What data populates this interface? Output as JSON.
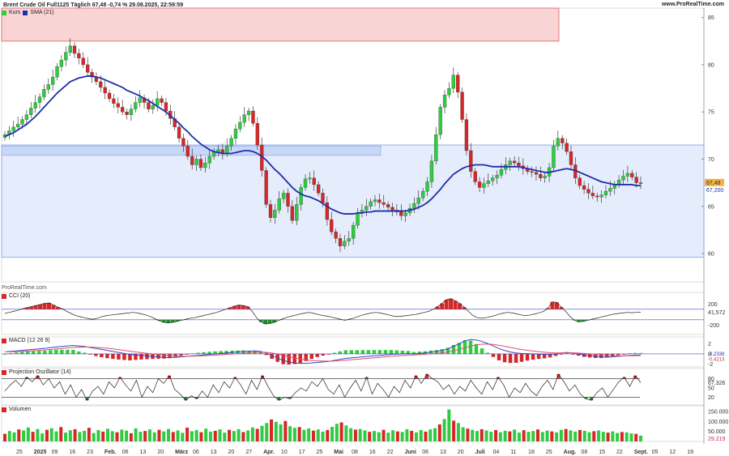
{
  "header": {
    "title": "Brent Crude Oil Full1125 Täglich 67,48 -0,74 % 29.08.2025, 22:59:59",
    "brand": "www.ProRealTime.com",
    "watermark": "ProRealTime.com"
  },
  "colors": {
    "up": "#2ecc40",
    "down": "#d62728",
    "sma": "#1f2fa8",
    "zone_blue": "#dfe7fb",
    "zone_red": "#f8c9c9",
    "macd_line": "#3446c8",
    "signal_line": "#e0506a"
  },
  "chart_data": [
    {
      "type": "candlestick",
      "legend": [
        "Kurs",
        "SMA (21)"
      ],
      "y_ticks": [
        "85",
        "80",
        "75",
        "70",
        "65",
        "60"
      ],
      "ylim": [
        57,
        86
      ],
      "last_price": "67,48",
      "sma_last": "67,200",
      "zones": [
        {
          "kind": "resistance",
          "from": 82.5,
          "to": 86
        },
        {
          "kind": "support",
          "from": 59.6,
          "to": 71.5
        }
      ],
      "x_ticks": [
        "25",
        "2025",
        "09",
        "16",
        "23",
        "Feb.",
        "06",
        "13",
        "20",
        "März",
        "06",
        "13",
        "20",
        "27",
        "Apr.",
        "10",
        "17",
        "25",
        "Mai",
        "08",
        "16",
        "22",
        "Juni",
        "06",
        "13",
        "20",
        "Juli",
        "04",
        "11",
        "18",
        "25",
        "Aug.",
        "08",
        "15",
        "22",
        "Sept.",
        "05",
        "12",
        "19"
      ],
      "closes": [
        72.6,
        73.0,
        73.4,
        73.7,
        74.2,
        74.7,
        75.4,
        76.0,
        76.6,
        77.4,
        77.9,
        78.7,
        79.8,
        80.5,
        81.3,
        82.0,
        81.2,
        80.7,
        80.0,
        79.2,
        78.7,
        78.2,
        77.6,
        77.0,
        76.4,
        75.9,
        75.5,
        75.0,
        74.7,
        75.3,
        76.0,
        76.5,
        76.0,
        75.3,
        75.7,
        76.4,
        76.0,
        75.1,
        74.3,
        73.4,
        72.2,
        71.4,
        70.3,
        69.4,
        70.0,
        69.1,
        69.6,
        70.3,
        70.8,
        71.0,
        70.6,
        71.4,
        72.2,
        73.2,
        73.9,
        74.7,
        75.1,
        73.8,
        71.5,
        68.8,
        65.2,
        63.8,
        64.6,
        65.8,
        66.4,
        65.0,
        63.5,
        65.2,
        67.0,
        67.9,
        68.0,
        67.3,
        66.4,
        65.4,
        63.6,
        62.3,
        61.6,
        60.8,
        61.3,
        61.6,
        63.0,
        64.3,
        64.6,
        65.0,
        65.5,
        65.7,
        65.4,
        65.2,
        64.9,
        64.6,
        64.4,
        64.0,
        64.3,
        64.8,
        65.3,
        65.9,
        66.6,
        67.6,
        69.8,
        72.6,
        75.5,
        76.8,
        77.5,
        78.9,
        77.1,
        74.2,
        70.9,
        68.7,
        67.6,
        67.0,
        67.4,
        67.7,
        68.0,
        68.3,
        68.9,
        69.4,
        69.8,
        69.6,
        69.3,
        69.0,
        68.7,
        68.6,
        68.4,
        68.0,
        68.2,
        69.1,
        71.4,
        72.2,
        71.7,
        70.8,
        69.4,
        68.0,
        67.2,
        66.8,
        66.4,
        66.1,
        66.0,
        66.2,
        66.6,
        66.9,
        67.3,
        67.8,
        68.2,
        68.5,
        68.1,
        67.5,
        67.48
      ],
      "sma": [
        72.4,
        72.6,
        72.8,
        73.1,
        73.4,
        73.7,
        74.1,
        74.5,
        75.0,
        75.5,
        76.0,
        76.5,
        77.0,
        77.4,
        77.8,
        78.2,
        78.4,
        78.6,
        78.7,
        78.8,
        78.8,
        78.7,
        78.6,
        78.4,
        78.2,
        78.0,
        77.8,
        77.6,
        77.3,
        77.1,
        76.9,
        76.7,
        76.4,
        76.2,
        75.9,
        75.6,
        75.3,
        75.0,
        74.6,
        74.2,
        73.8,
        73.3,
        72.9,
        72.4,
        72.0,
        71.6,
        71.3,
        71.0,
        70.8,
        70.7,
        70.6,
        70.6,
        70.6,
        70.7,
        70.8,
        70.9,
        70.9,
        70.8,
        70.6,
        70.3,
        69.9,
        69.4,
        68.9,
        68.5,
        68.0,
        67.5,
        67.0,
        66.6,
        66.3,
        66.1,
        66.0,
        65.8,
        65.6,
        65.3,
        65.0,
        64.7,
        64.5,
        64.3,
        64.2,
        64.2,
        64.2,
        64.3,
        64.3,
        64.4,
        64.4,
        64.5,
        64.5,
        64.5,
        64.5,
        64.5,
        64.5,
        64.5,
        64.5,
        64.6,
        64.7,
        64.9,
        65.1,
        65.4,
        65.8,
        66.3,
        66.8,
        67.4,
        67.9,
        68.4,
        68.7,
        69.0,
        69.2,
        69.3,
        69.4,
        69.4,
        69.4,
        69.3,
        69.2,
        69.2,
        69.2,
        69.2,
        69.2,
        69.2,
        69.2,
        69.1,
        69.0,
        68.9,
        68.8,
        68.7,
        68.6,
        68.6,
        68.7,
        68.8,
        68.9,
        69.0,
        68.9,
        68.8,
        68.6,
        68.4,
        68.2,
        68.0,
        67.8,
        67.6,
        67.5,
        67.4,
        67.3,
        67.3,
        67.3,
        67.3,
        67.3,
        67.2,
        67.2
      ]
    },
    {
      "type": "line",
      "name": "CCI (20)",
      "y_ticks": [
        "200",
        "-200"
      ],
      "ylim": [
        -380,
        420
      ],
      "last": "41,572",
      "levels": [
        100,
        -100
      ],
      "values": [
        20,
        40,
        60,
        80,
        110,
        130,
        150,
        170,
        190,
        210,
        220,
        180,
        140,
        110,
        60,
        20,
        -20,
        -40,
        -60,
        -80,
        -90,
        -70,
        -40,
        -20,
        -10,
        0,
        10,
        20,
        30,
        40,
        30,
        10,
        -10,
        -40,
        -80,
        -120,
        -150,
        -160,
        -150,
        -130,
        -110,
        -90,
        -70,
        -60,
        -40,
        -20,
        0,
        20,
        40,
        70,
        100,
        130,
        160,
        180,
        170,
        150,
        60,
        -60,
        -140,
        -180,
        -170,
        -150,
        -110,
        -80,
        -50,
        -30,
        -10,
        10,
        30,
        40,
        20,
        0,
        -20,
        -30,
        -50,
        -70,
        -90,
        -110,
        -90,
        -70,
        -40,
        -10,
        10,
        30,
        40,
        30,
        10,
        -10,
        -30,
        -40,
        -30,
        -20,
        -10,
        0,
        20,
        40,
        60,
        100,
        150,
        210,
        280,
        300,
        260,
        210,
        140,
        60,
        -20,
        -60,
        -70,
        -60,
        -40,
        -20,
        10,
        30,
        40,
        30,
        10,
        -10,
        -20,
        -10,
        10,
        30,
        60,
        120,
        240,
        230,
        140,
        60,
        -40,
        -110,
        -140,
        -130,
        -110,
        -90,
        -70,
        -50,
        -30,
        -10,
        10,
        20,
        30,
        40,
        35,
        40,
        41.572
      ]
    },
    {
      "type": "bar+line",
      "name": "MACD (12 26 9)",
      "y_ticks": [
        "2",
        "0",
        "-2"
      ],
      "ylim": [
        -2.6,
        3.4
      ],
      "last_macd": "-0,2338",
      "last_signal": "-0,4213",
      "macd": [
        0.4,
        0.5,
        0.6,
        0.7,
        0.8,
        0.9,
        1.0,
        1.1,
        1.25,
        1.4,
        1.5,
        1.6,
        1.7,
        1.6,
        1.5,
        1.3,
        1.1,
        0.9,
        0.7,
        0.5,
        0.3,
        0.1,
        -0.1,
        -0.2,
        -0.3,
        -0.4,
        -0.5,
        -0.6,
        -0.7,
        -0.75,
        -0.7,
        -0.6,
        -0.5,
        -0.4,
        -0.3,
        -0.2,
        -0.1,
        0.0,
        0.1,
        0.2,
        0.3,
        0.4,
        0.5,
        0.55,
        0.6,
        0.5,
        0.2,
        -0.3,
        -0.8,
        -1.3,
        -1.6,
        -1.8,
        -1.9,
        -1.9,
        -1.8,
        -1.7,
        -1.6,
        -1.5,
        -1.3,
        -1.1,
        -0.9,
        -0.8,
        -0.7,
        -0.6,
        -0.5,
        -0.4,
        -0.3,
        -0.2,
        -0.1,
        -0.05,
        0.0,
        0.05,
        0.0,
        0.1,
        0.2,
        0.35,
        0.5,
        0.7,
        1.0,
        1.5,
        2.0,
        2.6,
        2.9,
        2.8,
        2.5,
        2.1,
        1.6,
        1.1,
        0.7,
        0.4,
        0.2,
        0.1,
        0.05,
        0.0,
        -0.05,
        -0.1,
        -0.1,
        0.0,
        0.2,
        0.3,
        0.2,
        0.0,
        -0.2,
        -0.35,
        -0.5,
        -0.6,
        -0.65,
        -0.6,
        -0.5,
        -0.4,
        -0.3,
        -0.25,
        -0.23
      ]
    },
    {
      "type": "line",
      "name": "Projection Oszillator (14)",
      "y_ticks": [
        "80",
        "50",
        "20"
      ],
      "ylim": [
        -5,
        105
      ],
      "last": "67,326",
      "levels": [
        80,
        20
      ],
      "values": [
        40,
        60,
        75,
        55,
        85,
        70,
        90,
        60,
        80,
        50,
        70,
        30,
        60,
        20,
        45,
        10,
        40,
        55,
        30,
        70,
        50,
        85,
        60,
        40,
        75,
        20,
        55,
        35,
        80,
        65,
        90,
        45,
        30,
        10,
        25,
        15,
        40,
        20,
        60,
        35,
        70,
        50,
        85,
        60,
        30,
        75,
        45,
        90,
        55,
        25,
        10,
        20,
        15,
        35,
        50,
        40,
        70,
        55,
        80,
        45,
        30,
        60,
        20,
        50,
        75,
        40,
        85,
        30,
        65,
        45,
        20,
        55,
        35,
        75,
        50,
        90,
        65,
        95,
        80,
        70,
        45,
        60,
        30,
        55,
        40,
        75,
        50,
        30,
        70,
        45,
        85,
        60,
        20,
        50,
        35,
        65,
        40,
        25,
        55,
        75,
        45,
        95,
        70,
        40,
        60,
        30,
        15,
        10,
        35,
        50,
        20,
        45,
        70,
        85,
        55,
        90,
        67.3
      ]
    },
    {
      "type": "bar",
      "name": "Volumen",
      "y_ticks": [
        "150.000",
        "100.000",
        "50.000"
      ],
      "ylim": [
        0,
        170000
      ],
      "last": "29.219",
      "values": [
        38000,
        52000,
        45000,
        60000,
        55000,
        70000,
        48000,
        62000,
        40000,
        58000,
        66000,
        50000,
        72000,
        44000,
        56000,
        61000,
        47000,
        53000,
        68000,
        42000,
        57000,
        49000,
        63000,
        51000,
        46000,
        59000,
        54000,
        41000,
        65000,
        48000,
        52000,
        60000,
        45000,
        58000,
        50000,
        62000,
        47000,
        55000,
        43000,
        69000,
        51000,
        57000,
        46000,
        64000,
        49000,
        53000,
        60000,
        44000,
        58000,
        52000,
        61000,
        47000,
        55000,
        70000,
        63000,
        78000,
        92000,
        110000,
        98000,
        85000,
        102000,
        76000,
        68000,
        72000,
        58000,
        65000,
        54000,
        60000,
        49000,
        57000,
        73000,
        88000,
        95000,
        80000,
        66000,
        59000,
        62000,
        55000,
        48000,
        52000,
        46000,
        58000,
        44000,
        56000,
        50000,
        47000,
        61000,
        53000,
        45000,
        57000,
        49000,
        60000,
        66000,
        85000,
        112000,
        160000,
        104000,
        92000,
        71000,
        64000,
        58000,
        52000,
        61000,
        55000,
        48000,
        57000,
        46000,
        53000,
        50000,
        59000,
        44000,
        56000,
        48000,
        52000,
        60000,
        47000,
        54000,
        50000,
        45000,
        58000,
        62000,
        55000,
        49000,
        57000,
        53000,
        46000,
        51000,
        55000,
        48000,
        44000,
        50000,
        42000,
        47000,
        45000,
        40000,
        38000,
        29219
      ]
    }
  ]
}
